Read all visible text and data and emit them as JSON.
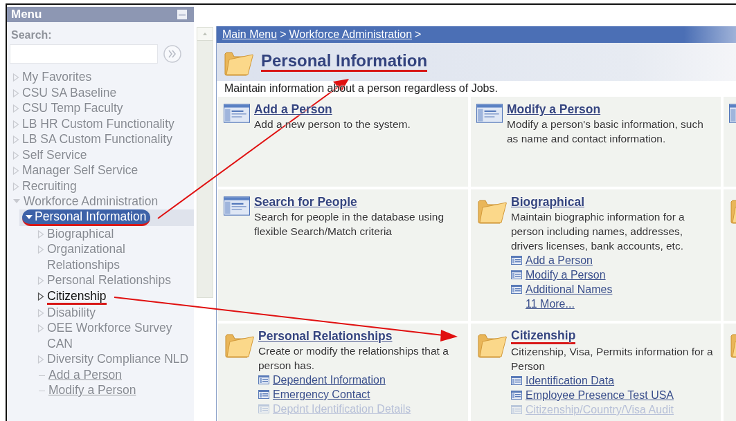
{
  "menu": {
    "title": "Menu",
    "search_label": "Search:",
    "items": [
      {
        "text": "My Favorites",
        "kind": "folder",
        "expanded": false,
        "selected": false,
        "dimmed": true,
        "annotated": false
      },
      {
        "text": "CSU SA Baseline",
        "kind": "folder",
        "expanded": false,
        "selected": false,
        "dimmed": true,
        "annotated": false
      },
      {
        "text": "CSU Temp Faculty",
        "kind": "folder",
        "expanded": false,
        "selected": false,
        "dimmed": true,
        "annotated": false
      },
      {
        "text": "LB HR Custom Functionality",
        "kind": "folder",
        "expanded": false,
        "selected": false,
        "dimmed": true,
        "annotated": false
      },
      {
        "text": "LB SA Custom Functionality",
        "kind": "folder",
        "expanded": false,
        "selected": false,
        "dimmed": true,
        "annotated": false
      },
      {
        "text": "Self Service",
        "kind": "folder",
        "expanded": false,
        "selected": false,
        "dimmed": true,
        "annotated": false
      },
      {
        "text": "Manager Self Service",
        "kind": "folder",
        "expanded": false,
        "selected": false,
        "dimmed": true,
        "annotated": false
      },
      {
        "text": "Recruiting",
        "kind": "folder",
        "expanded": false,
        "selected": false,
        "dimmed": true,
        "annotated": false
      },
      {
        "text": "Workforce Administration",
        "kind": "folder",
        "expanded": true,
        "selected": false,
        "dimmed": true,
        "annotated": false,
        "children": [
          {
            "text": "Personal Information",
            "kind": "folder",
            "expanded": true,
            "selected": true,
            "dimmed": false,
            "annotated": true,
            "children": [
              {
                "text": "Biographical",
                "kind": "folder",
                "expanded": false,
                "selected": false,
                "dimmed": true,
                "annotated": false
              },
              {
                "text": "Organizational Relationships",
                "kind": "folder",
                "expanded": false,
                "selected": false,
                "dimmed": true,
                "annotated": false
              },
              {
                "text": "Personal Relationships",
                "kind": "folder",
                "expanded": false,
                "selected": false,
                "dimmed": true,
                "annotated": false
              },
              {
                "text": "Citizenship",
                "kind": "folder",
                "expanded": false,
                "selected": false,
                "dimmed": false,
                "annotated": true
              },
              {
                "text": "Disability",
                "kind": "folder",
                "expanded": false,
                "selected": false,
                "dimmed": true,
                "annotated": false
              },
              {
                "text": "OEE Workforce Survey CAN",
                "kind": "folder",
                "expanded": false,
                "selected": false,
                "dimmed": true,
                "annotated": false
              },
              {
                "text": "Diversity Compliance NLD",
                "kind": "folder",
                "expanded": false,
                "selected": false,
                "dimmed": true,
                "annotated": false
              },
              {
                "text": "Add a Person",
                "kind": "link",
                "selected": false,
                "dimmed": true,
                "annotated": false
              },
              {
                "text": "Modify a Person",
                "kind": "link",
                "selected": false,
                "dimmed": true,
                "annotated": false
              }
            ]
          }
        ]
      }
    ]
  },
  "breadcrumb": [
    {
      "kind": "link",
      "text": "Main Menu"
    },
    {
      "kind": "separator",
      "text": ">"
    },
    {
      "kind": "link",
      "text": "Workforce Administration"
    },
    {
      "kind": "separator",
      "text": ">"
    }
  ],
  "page": {
    "title": "Personal Information",
    "annotated": true,
    "description": "Maintain information about a person regardless of Jobs."
  },
  "cards": [
    [
      {
        "kind": "page",
        "title": "Add a Person",
        "annotated": false,
        "description": "Add a new person to the system."
      },
      {
        "kind": "page",
        "title": "Modify a Person",
        "annotated": false,
        "description": "Modify a person's basic information, such as name and contact information."
      },
      {
        "kind": "page"
      }
    ],
    [
      {
        "kind": "page",
        "title": "Search for People",
        "annotated": false,
        "description": "Search for people in the database using flexible Search/Match criteria"
      },
      {
        "kind": "folder",
        "title": "Biographical",
        "annotated": false,
        "description": "Maintain biographic information for a person including names, addresses, drivers licenses, bank accounts, etc.",
        "links": [
          {
            "kind": "page",
            "text": "Add a Person",
            "dimmed": false
          },
          {
            "kind": "page",
            "text": "Modify a Person",
            "dimmed": false
          },
          {
            "kind": "page",
            "text": "Additional Names",
            "dimmed": false
          },
          {
            "kind": "more",
            "text": "11 More...",
            "dimmed": false
          }
        ]
      },
      {
        "kind": "folder"
      }
    ],
    [
      {
        "kind": "folder",
        "title": "Personal Relationships",
        "annotated": false,
        "description": "Create or modify the relationships that a person has.",
        "links": [
          {
            "kind": "page",
            "text": "Dependent Information",
            "dimmed": false
          },
          {
            "kind": "page",
            "text": "Emergency Contact",
            "dimmed": false
          },
          {
            "kind": "page",
            "text": "Depdnt Identification Details",
            "dimmed": true
          }
        ]
      },
      {
        "kind": "folder",
        "title": "Citizenship",
        "annotated": true,
        "description": "Citizenship, Visa, Permits information for a Person",
        "links": [
          {
            "kind": "page",
            "text": "Identification Data",
            "dimmed": false
          },
          {
            "kind": "page",
            "text": "Employee Presence Test USA",
            "dimmed": false
          },
          {
            "kind": "page",
            "text": "Citizenship/Country/Visa Audit",
            "dimmed": true
          }
        ]
      },
      {
        "kind": "folder"
      }
    ]
  ]
}
